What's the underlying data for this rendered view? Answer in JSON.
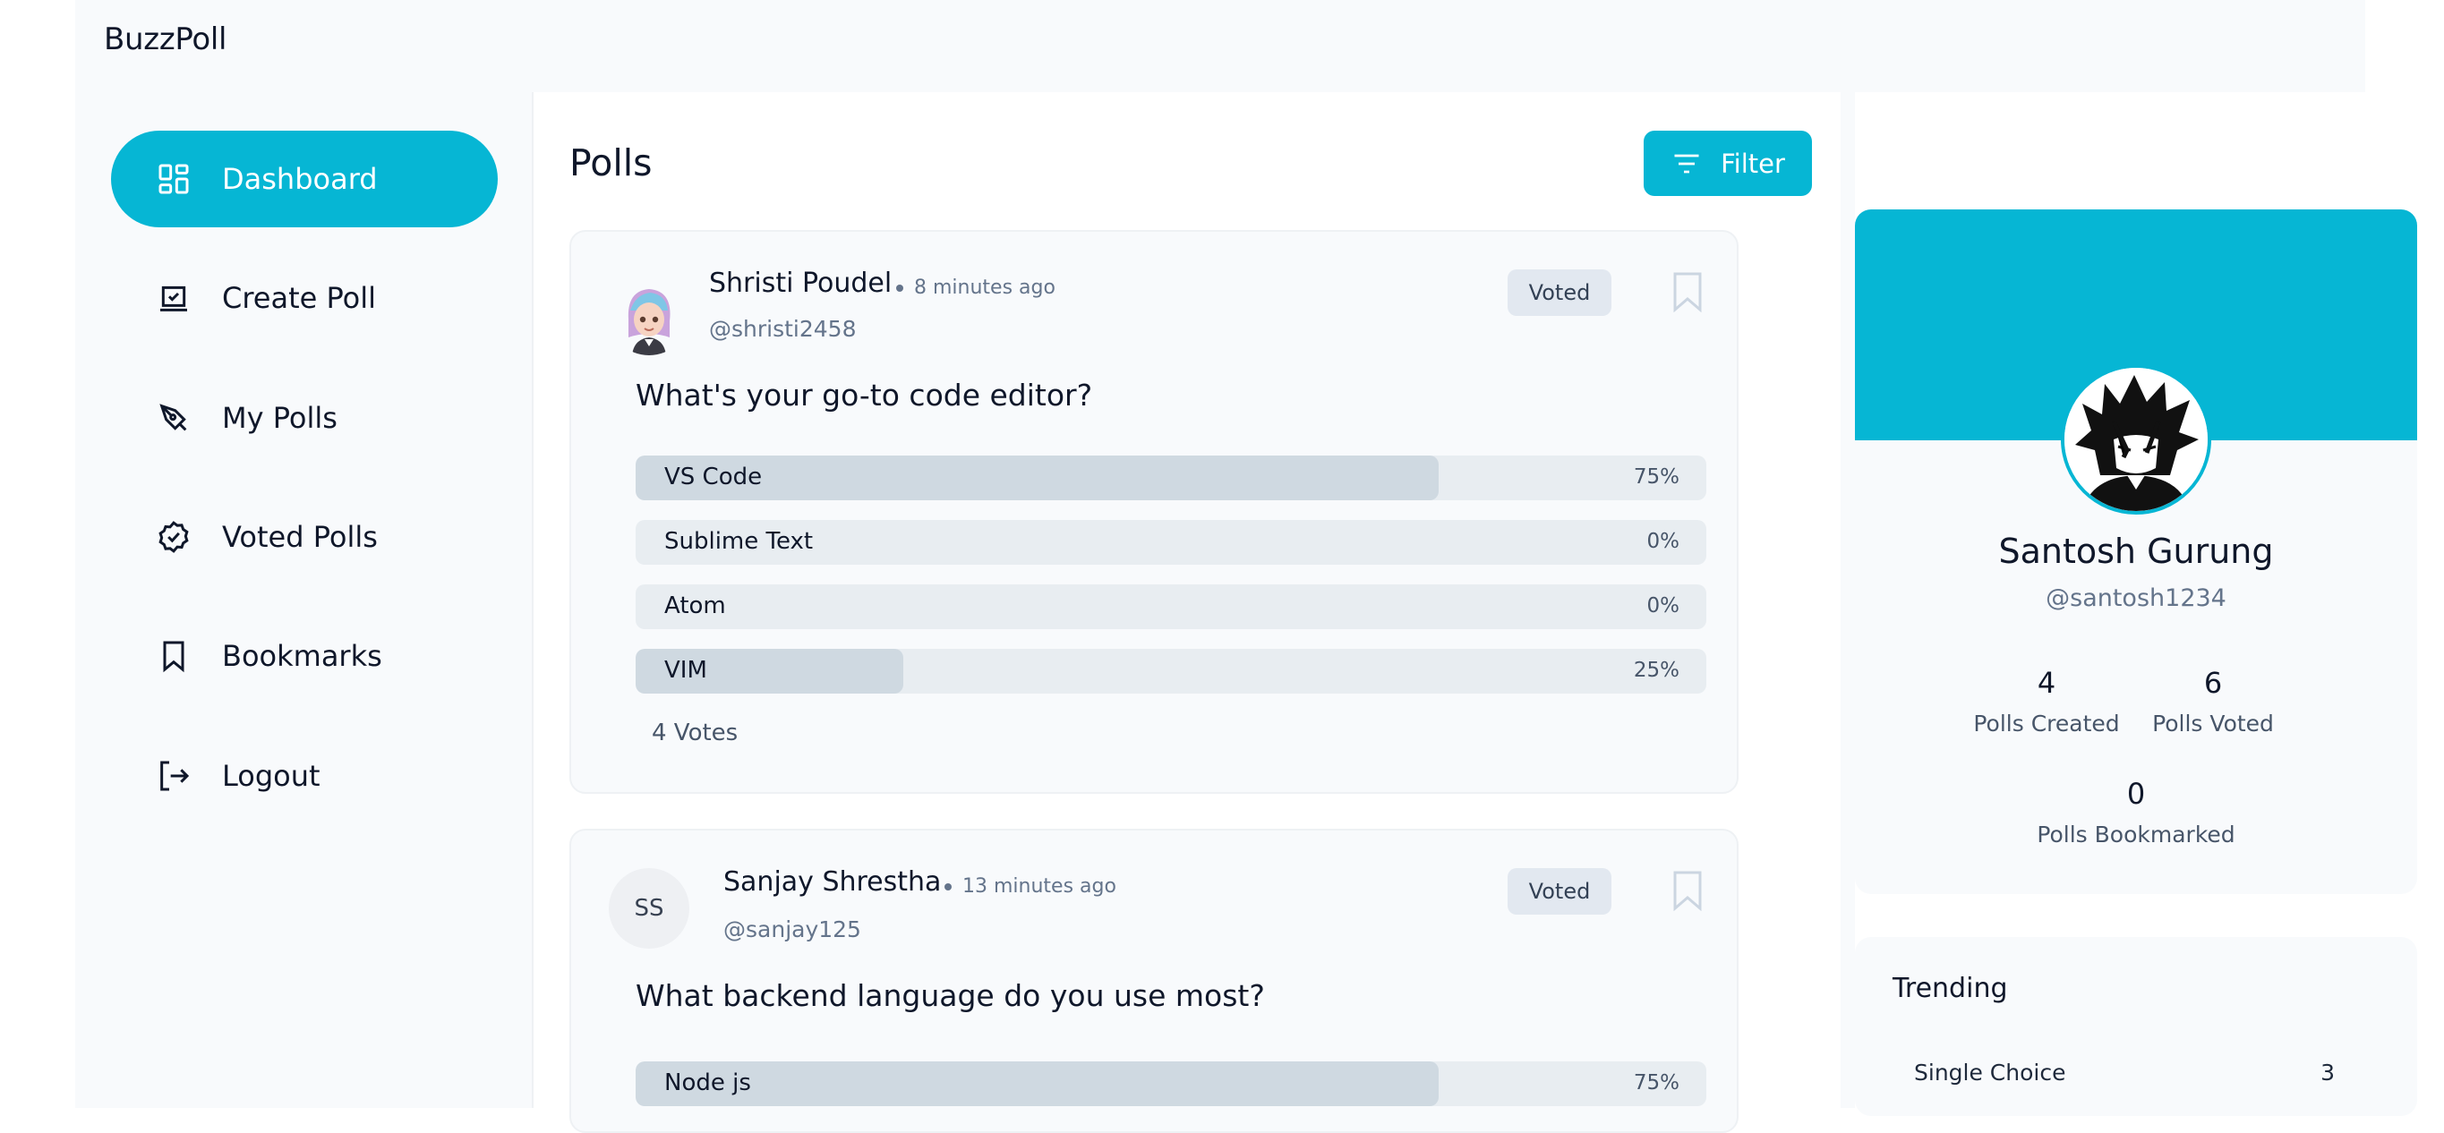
{
  "app": {
    "brand": "BuzzPoll"
  },
  "sidebar": {
    "items": [
      {
        "label": "Dashboard",
        "icon": "dashboard-icon",
        "active": true
      },
      {
        "label": "Create Poll",
        "icon": "create-poll-icon",
        "active": false
      },
      {
        "label": "My Polls",
        "icon": "pen-icon",
        "active": false
      },
      {
        "label": "Voted Polls",
        "icon": "check-badge-icon",
        "active": false
      },
      {
        "label": "Bookmarks",
        "icon": "bookmark-icon",
        "active": false
      },
      {
        "label": "Logout",
        "icon": "logout-icon",
        "active": false
      }
    ]
  },
  "main": {
    "title": "Polls",
    "filter_label": "Filter",
    "polls": [
      {
        "author": "Shristi Poudel",
        "time": "8 minutes ago",
        "handle": "@shristi2458",
        "badge": "Voted",
        "question": "What's your go-to code editor?",
        "options": [
          {
            "label": "VS Code",
            "percent_text": "75%",
            "percent": 75
          },
          {
            "label": "Sublime Text",
            "percent_text": "0%",
            "percent": 0
          },
          {
            "label": "Atom",
            "percent_text": "0%",
            "percent": 0
          },
          {
            "label": "VIM",
            "percent_text": "25%",
            "percent": 25
          }
        ],
        "votes": "4 Votes"
      },
      {
        "author": "Sanjay Shrestha",
        "time": "13 minutes ago",
        "handle": "@sanjay125",
        "initials": "SS",
        "badge": "Voted",
        "question": "What backend language do you use most?",
        "options": [
          {
            "label": "Node js",
            "percent_text": "75%",
            "percent": 75
          }
        ]
      }
    ]
  },
  "profile": {
    "name": "Santosh Gurung",
    "handle": "@santosh1234",
    "stats": [
      {
        "value": "4",
        "label": "Polls Created"
      },
      {
        "value": "6",
        "label": "Polls Voted"
      },
      {
        "value": "0",
        "label": "Polls Bookmarked"
      }
    ]
  },
  "trending": {
    "title": "Trending",
    "items": [
      {
        "label": "Single Choice",
        "count": "3"
      }
    ]
  },
  "colors": {
    "accent": "#06b6d4",
    "fill": "#cfd9e1",
    "track": "#e8edf1"
  }
}
